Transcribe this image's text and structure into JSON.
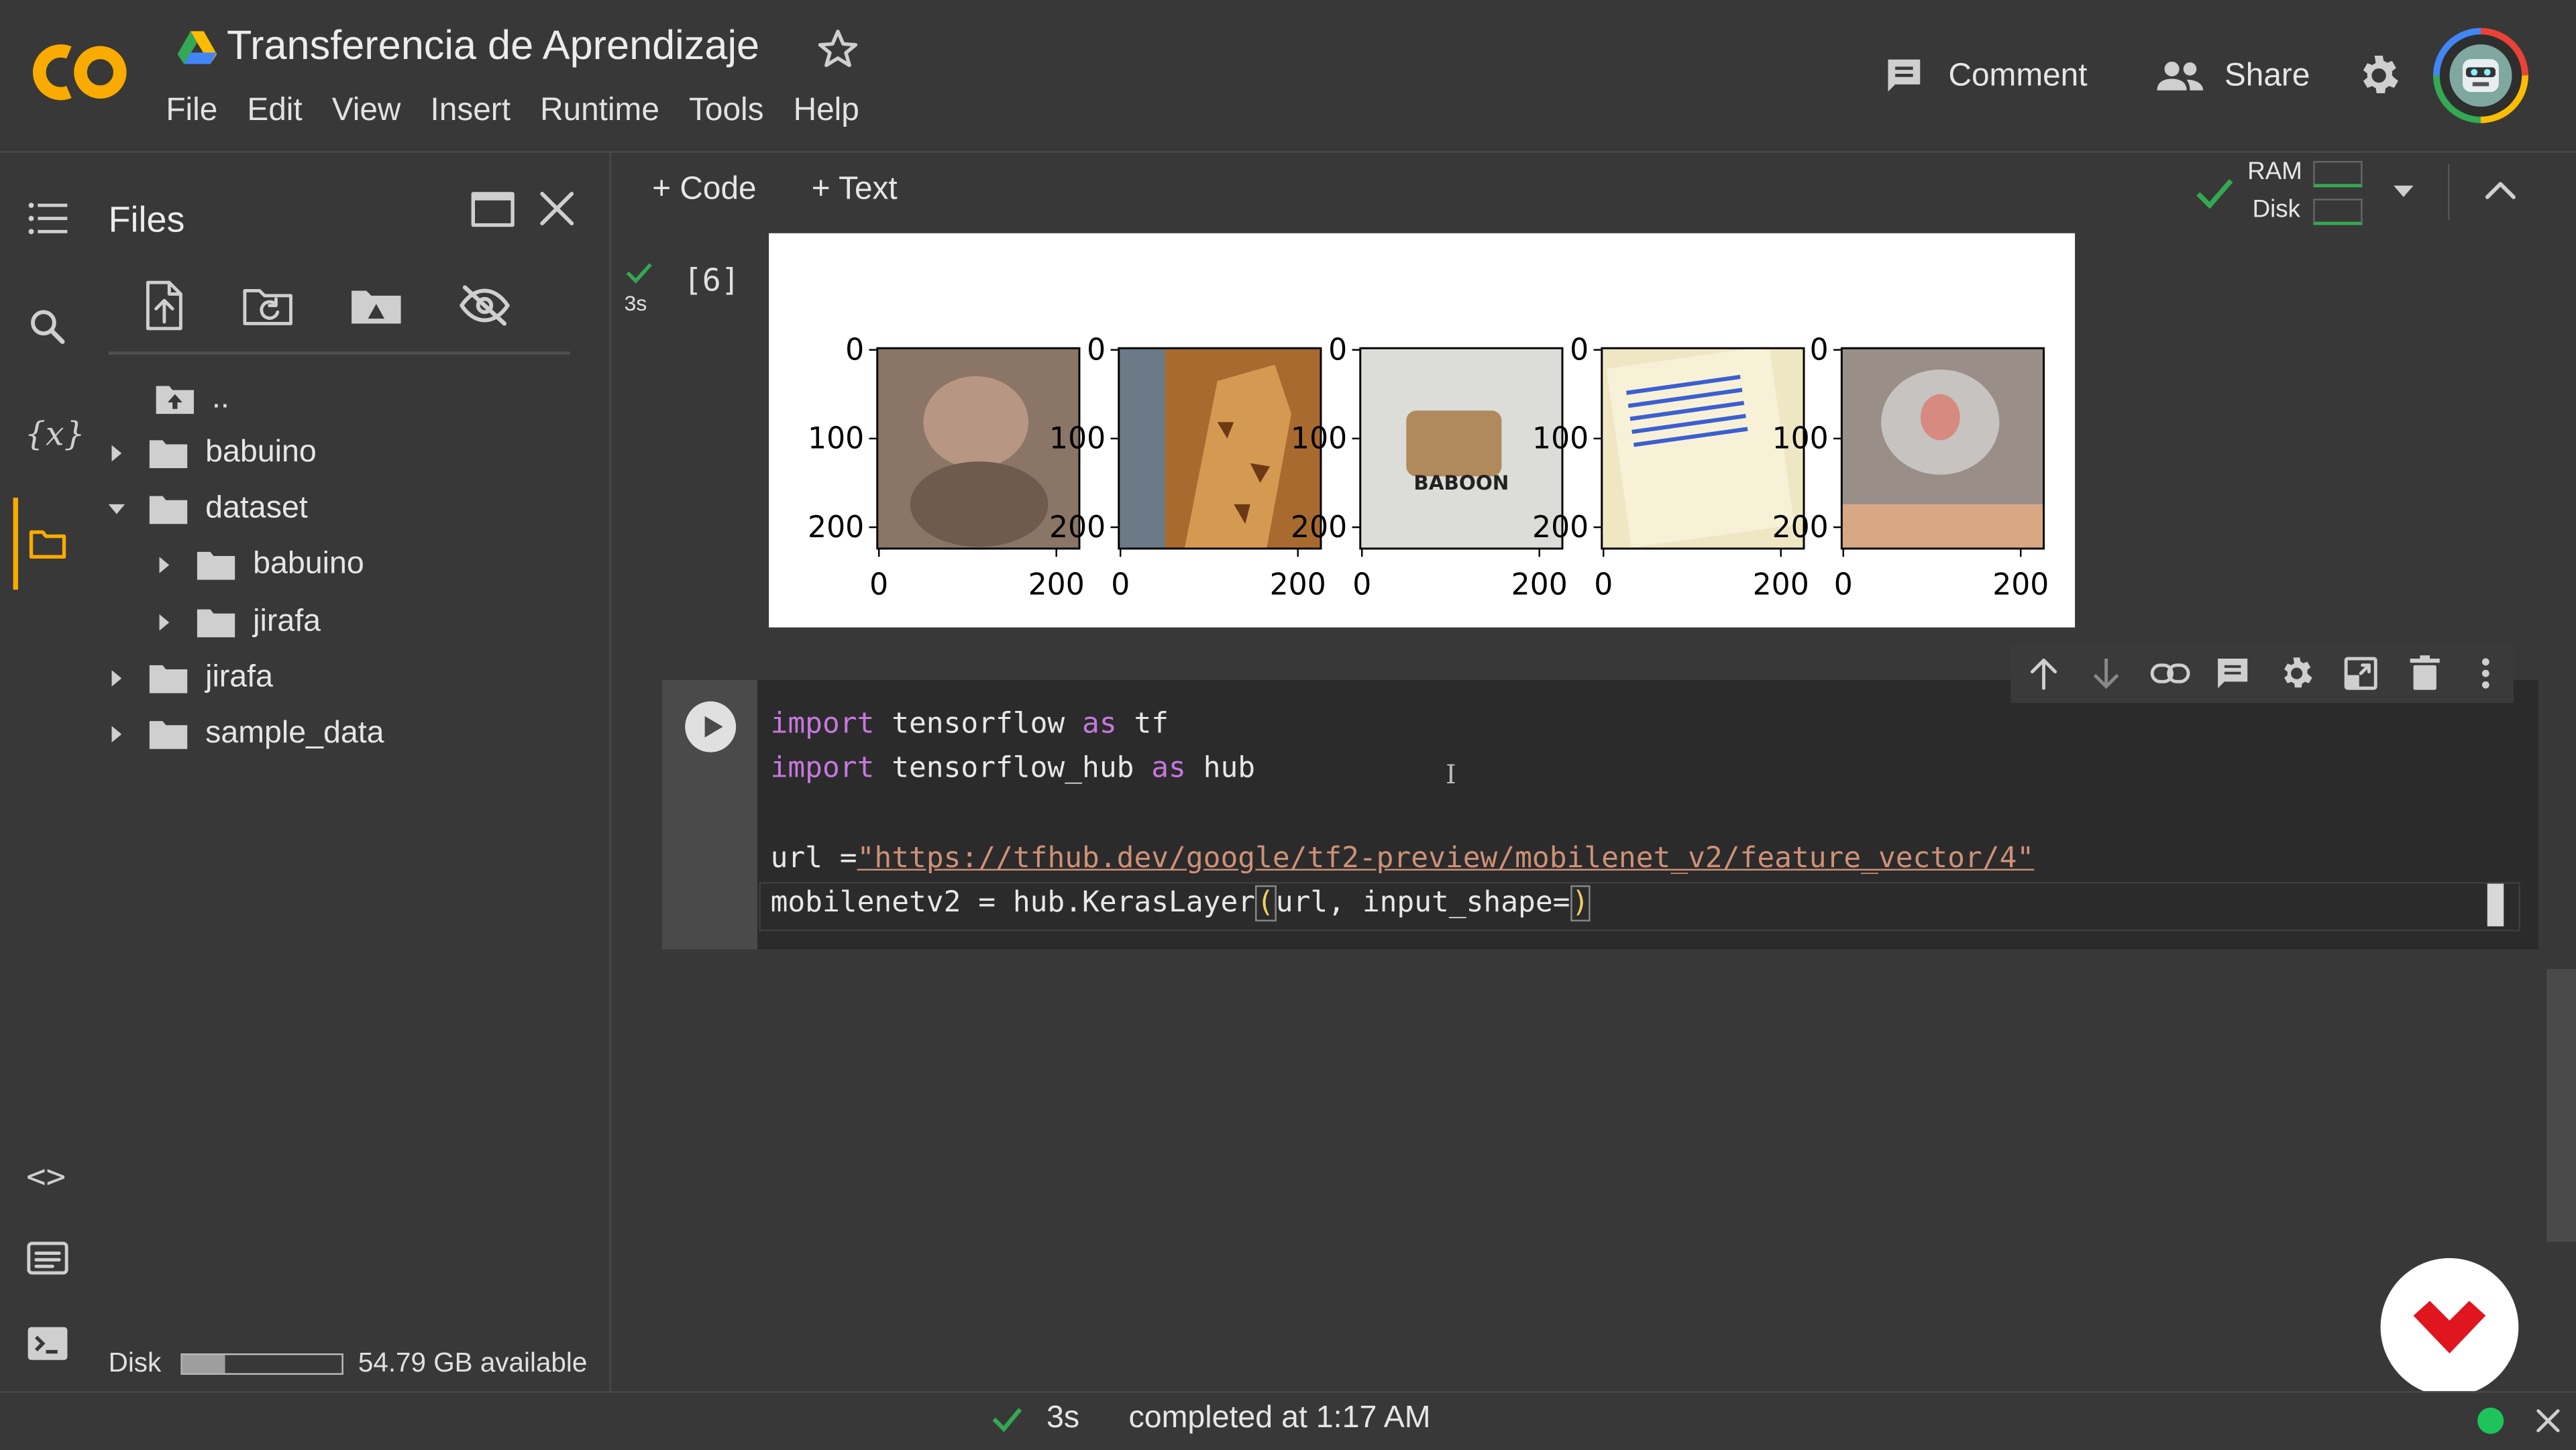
{
  "app": {
    "logo": "CO",
    "title": "Transferencia de Aprendizaje",
    "menu": [
      "File",
      "Edit",
      "View",
      "Insert",
      "Runtime",
      "Tools",
      "Help"
    ],
    "header_actions": {
      "comment_label": "Comment",
      "share_label": "Share"
    }
  },
  "sidebar": {
    "title": "Files",
    "tree": [
      {
        "label": ".."
      },
      {
        "label": "babuino"
      },
      {
        "label": "dataset"
      },
      {
        "label": "babuino"
      },
      {
        "label": "jirafa"
      },
      {
        "label": "jirafa"
      },
      {
        "label": "sample_data"
      }
    ],
    "disk_label": "Disk",
    "disk_available": "54.79 GB available",
    "disk_used_fraction": 0.27
  },
  "toolbar": {
    "code_label": "+ Code",
    "text_label": "+ Text",
    "ram_label": "RAM",
    "disk_label": "Disk"
  },
  "output_cell": {
    "exec_count": "[6]",
    "exec_time": "3s",
    "subplots": [
      {
        "y_ticks": [
          "0",
          "100",
          "200"
        ],
        "x_ticks": [
          "0",
          "200"
        ],
        "color": "#8a7566",
        "image_text": ""
      },
      {
        "y_ticks": [
          "0",
          "100",
          "200"
        ],
        "x_ticks": [
          "0",
          "200"
        ],
        "color": "#a86a2e",
        "image_text": ""
      },
      {
        "y_ticks": [
          "0",
          "100",
          "200"
        ],
        "x_ticks": [
          "0",
          "200"
        ],
        "color": "#dcdcd8",
        "image_text": "BABOON"
      },
      {
        "y_ticks": [
          "0",
          "100",
          "200"
        ],
        "x_ticks": [
          "0",
          "200"
        ],
        "color": "#efe6c4",
        "image_text": ""
      },
      {
        "y_ticks": [
          "0",
          "100",
          "200"
        ],
        "x_ticks": [
          "0",
          "200"
        ],
        "color": "#9a8f88",
        "image_text": ""
      }
    ]
  },
  "code_cell": {
    "lines": [
      [
        {
          "t": "import",
          "c": "kw"
        },
        {
          "t": " tensorflow ",
          "c": ""
        },
        {
          "t": "as",
          "c": "kw"
        },
        {
          "t": " tf",
          "c": ""
        }
      ],
      [
        {
          "t": "import",
          "c": "kw"
        },
        {
          "t": " tensorflow_hub ",
          "c": ""
        },
        {
          "t": "as",
          "c": "kw"
        },
        {
          "t": " hub",
          "c": ""
        }
      ],
      [],
      [
        {
          "t": "url =",
          "c": ""
        },
        {
          "t": "\"https://tfhub.dev/google/tf2-preview/mobilenet_v2/feature_vector/4\"",
          "c": "str"
        }
      ],
      [
        {
          "t": "mobilenetv2 = hub.KerasLayer",
          "c": ""
        },
        {
          "t": "(",
          "c": "paren"
        },
        {
          "t": "url, input_shape=",
          "c": ""
        },
        {
          "t": ")",
          "c": "paren"
        }
      ]
    ]
  },
  "statusbar": {
    "time": "3s",
    "message": "completed at 1:17 AM"
  },
  "colors": {
    "accent_orange": "#f9ab00",
    "success_green": "#34a853",
    "keyword": "#c678dd",
    "string": "#ce9178",
    "brand_red": "#e0161e"
  }
}
